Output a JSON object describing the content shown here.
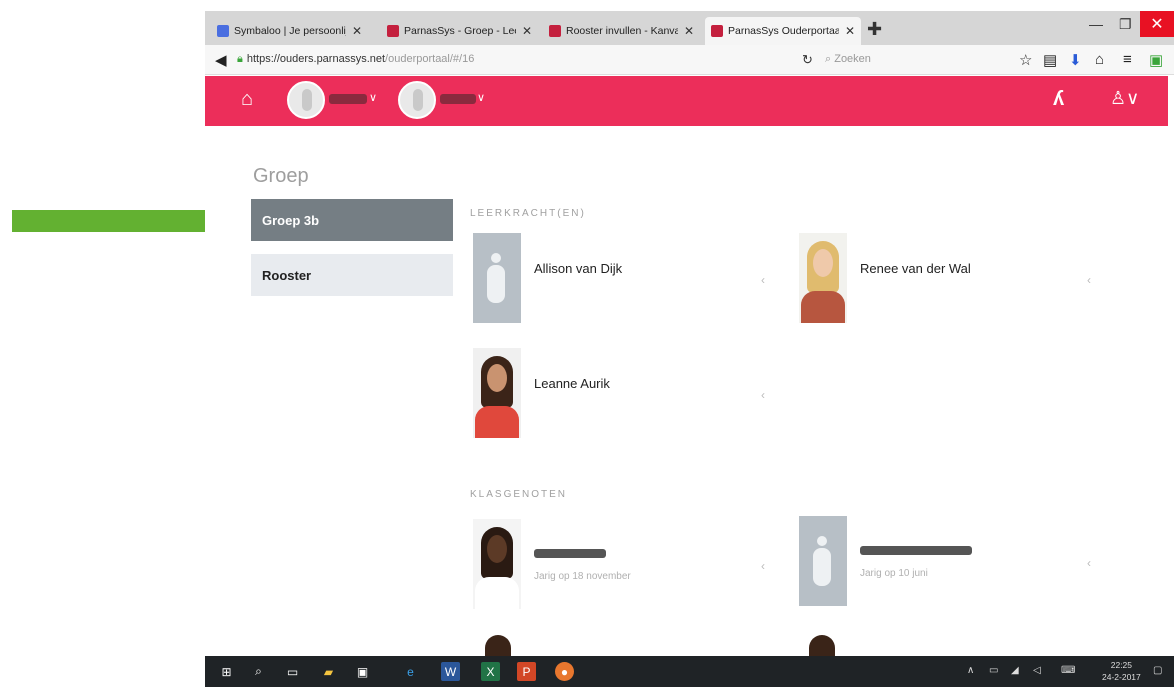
{
  "browser": {
    "tabs": [
      {
        "label": "Symbaloo | Je persoonlijk...",
        "color": "#4a6ee0",
        "active": false
      },
      {
        "label": "ParnasSys - Groep - Leerp...",
        "color": "#c4203e",
        "active": false
      },
      {
        "label": "Rooster invullen - Kanvas...",
        "color": "#c4203e",
        "active": false
      },
      {
        "label": "ParnasSys Ouderportaal - ...",
        "color": "#c4203e",
        "active": true
      }
    ],
    "url_host": "https://ouders.parnassys.net",
    "url_path": "/ouderportaal/#/16",
    "search_placeholder": "Zoeken"
  },
  "app": {
    "accent_color": "#ec2e5a",
    "children": [
      {
        "name": "",
        "redacted": true
      },
      {
        "name": "",
        "redacted": true
      }
    ]
  },
  "sidebar": {
    "title": "Groep",
    "items": [
      {
        "label": "Groep 3b",
        "active": true
      },
      {
        "label": "Rooster",
        "active": false
      }
    ]
  },
  "sections": {
    "teachers_title": "LEERKRACHT(EN)",
    "teachers": [
      {
        "name": "Allison van Dijk",
        "photo": "placeholder"
      },
      {
        "name": "Renee van der Wal",
        "photo": "blonde"
      },
      {
        "name": "Leanne Aurik",
        "photo": "dark"
      }
    ],
    "classmates_title": "KLASGENOTEN",
    "classmates": [
      {
        "name": "",
        "subtitle": "Jarig op 18 november",
        "photo": "child"
      },
      {
        "name": "",
        "subtitle": "Jarig op 10 juni",
        "photo": "placeholder"
      }
    ]
  },
  "taskbar": {
    "time": "22:25",
    "date": "24-2-2017"
  },
  "icons": [
    "home-icon",
    "back-icon",
    "lock-icon",
    "reload-icon",
    "search-icon",
    "star-icon",
    "clipboard-icon",
    "download-icon",
    "home-toolbar-icon",
    "menu-icon",
    "user-icon",
    "chevron-right-icon"
  ]
}
